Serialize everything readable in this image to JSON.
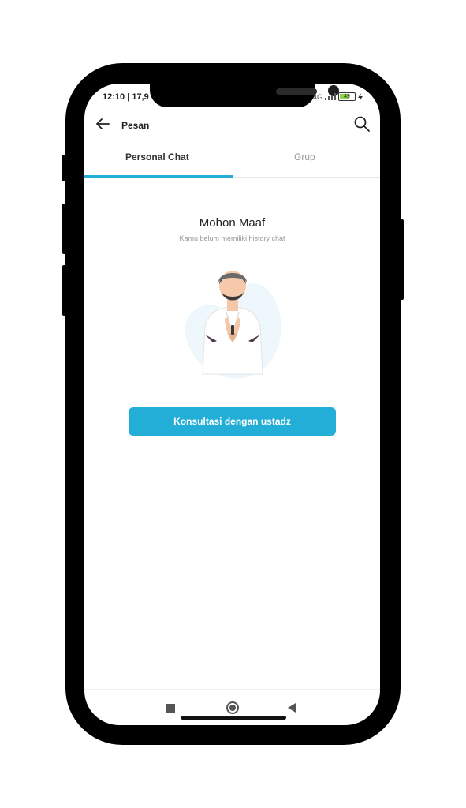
{
  "status_bar": {
    "time": "12:10 | 17,9",
    "network": "4G",
    "battery": "49"
  },
  "header": {
    "title": "Pesan",
    "back_icon": "arrow-left-icon",
    "search_icon": "search-icon"
  },
  "tabs": [
    {
      "label": "Personal Chat",
      "active": true
    },
    {
      "label": "Grup",
      "active": false
    }
  ],
  "empty_state": {
    "title": "Mohon Maaf",
    "subtitle": "Kamu belum memiliki history chat",
    "illustration": "praying-man-illustration"
  },
  "cta": {
    "label": "Konsultasi dengan ustadz"
  },
  "colors": {
    "accent": "#22aed6",
    "text": "#222222",
    "muted": "#999999"
  }
}
